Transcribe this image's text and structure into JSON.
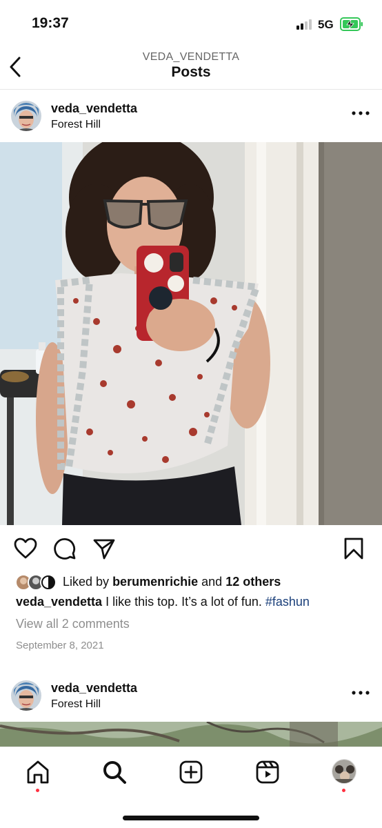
{
  "status_bar": {
    "time": "19:37",
    "network": "5G",
    "signal_bars_active": 2,
    "signal_bars_total": 4,
    "battery_charging": true,
    "battery_color": "#34c759"
  },
  "header": {
    "username": "VEDA_VENDETTA",
    "title": "Posts"
  },
  "posts": [
    {
      "username": "veda_vendetta",
      "location": "Forest Hill",
      "liked_by_prefix": "Liked by",
      "liked_by_user": "berumenrichie",
      "liked_by_joiner": "and",
      "liked_by_others": "12 others",
      "caption_user": "veda_vendetta",
      "caption_text": "I like this top. It’s a lot of fun.",
      "hashtag": "#fashun",
      "view_comments": "View all 2 comments",
      "date": "September 8, 2021"
    },
    {
      "username": "veda_vendetta",
      "location": "Forest Hill"
    }
  ],
  "actions": [
    "heart-icon",
    "comment-icon",
    "share-icon",
    "bookmark-icon"
  ],
  "tab_bar": {
    "tabs": [
      "home-icon",
      "search-icon",
      "new-post-icon",
      "reels-icon",
      "profile-avatar"
    ],
    "notification_dot_color": "#ff3040"
  },
  "colors": {
    "hashtag": "#1a3f7a",
    "secondary_text": "#8e8e8e"
  }
}
